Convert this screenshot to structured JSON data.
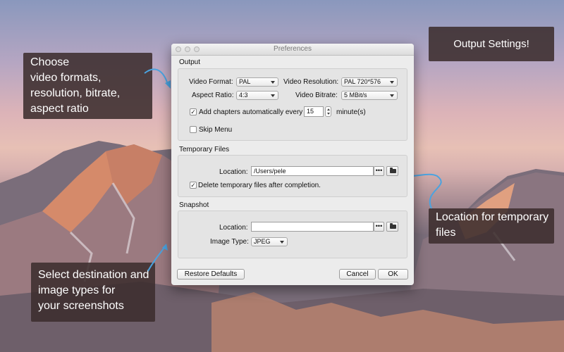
{
  "callouts": {
    "formats": [
      "Choose",
      "video formats,",
      "resolution, bitrate,",
      "aspect ratio"
    ],
    "output": "Output Settings!",
    "temp": [
      "Location for temporary",
      "files"
    ],
    "snapshot": [
      "Select destination and",
      "image types for",
      "your screenshots"
    ]
  },
  "window": {
    "title": "Preferences",
    "output": {
      "section_title": "Output",
      "video_format_label": "Video Format:",
      "video_format_value": "PAL",
      "video_resolution_label": "Video Resolution:",
      "video_resolution_value": "PAL 720*576",
      "aspect_ratio_label": "Aspect Ratio:",
      "aspect_ratio_value": "4:3",
      "video_bitrate_label": "Video Bitrate:",
      "video_bitrate_value": "5 MBit/s",
      "add_chapters_label": "Add chapters automatically every",
      "add_chapters_checked": true,
      "chapter_interval": "15",
      "minutes_label": "minute(s)",
      "skip_menu_label": "Skip Menu",
      "skip_menu_checked": false
    },
    "temporary": {
      "section_title": "Temporary Files",
      "location_label": "Location:",
      "location_value": "/Users/pele",
      "browse_label": "•••",
      "delete_label": "Delete temporary files after completion.",
      "delete_checked": true
    },
    "snapshot": {
      "section_title": "Snapshot",
      "location_label": "Location:",
      "location_value": "",
      "browse_label": "•••",
      "image_type_label": "Image Type:",
      "image_type_value": "JPEG"
    },
    "buttons": {
      "restore": "Restore Defaults",
      "cancel": "Cancel",
      "ok": "OK"
    }
  },
  "colors": {
    "arrow": "#4aa3e0",
    "callout_bg": "#3c2d2d"
  }
}
